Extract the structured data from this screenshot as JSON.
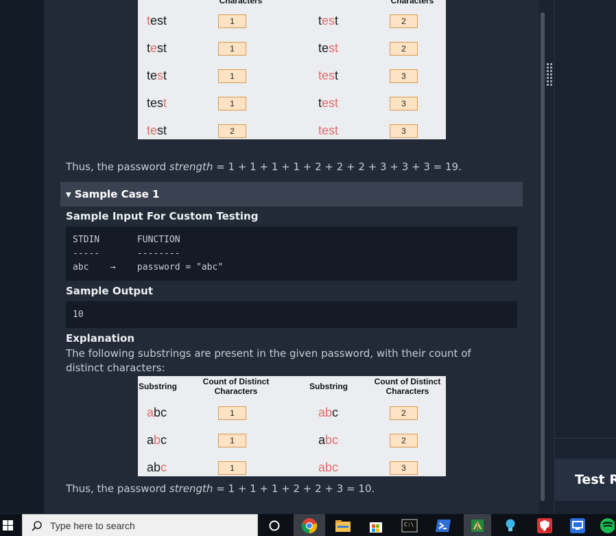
{
  "table1": {
    "header_left": "Characters",
    "header_right": "Characters",
    "rows": [
      {
        "left": {
          "pre": "",
          "hl": "t",
          "post": "est"
        },
        "left_count": "1",
        "right": {
          "pre": "t",
          "hl": "es",
          "post": "t"
        },
        "right_count": "2"
      },
      {
        "left": {
          "pre": "t",
          "hl": "e",
          "post": "st"
        },
        "left_count": "1",
        "right": {
          "pre": "te",
          "hl": "st",
          "post": ""
        },
        "right_count": "2"
      },
      {
        "left": {
          "pre": "te",
          "hl": "s",
          "post": "t"
        },
        "left_count": "1",
        "right": {
          "pre": "",
          "hl": "tes",
          "post": "t"
        },
        "right_count": "3"
      },
      {
        "left": {
          "pre": "tes",
          "hl": "t",
          "post": ""
        },
        "left_count": "1",
        "right": {
          "pre": "t",
          "hl": "est",
          "post": ""
        },
        "right_count": "3"
      },
      {
        "left": {
          "pre": "",
          "hl": "te",
          "post": "st"
        },
        "left_count": "2",
        "right": {
          "pre": "",
          "hl": "test",
          "post": ""
        },
        "right_count": "3"
      }
    ]
  },
  "strength0": {
    "prefix": "Thus, the password ",
    "word": "strength",
    "suffix": " = 1 + 1 + 1 + 1 + 2 + 2 + 2 + 3 + 3 + 3 = 19."
  },
  "sample_case": {
    "label": "▾ Sample Case 1"
  },
  "custom_input": {
    "title": "Sample Input For Custom Testing",
    "lines": [
      "STDIN       FUNCTION",
      "-----       --------",
      "abc    →    password = \"abc\""
    ]
  },
  "sample_output": {
    "title": "Sample Output",
    "value": "10"
  },
  "explanation": {
    "title": "Explanation",
    "text": "The following substrings are present in the given password, with their count of distinct characters:"
  },
  "table2": {
    "col1": "Substring",
    "col2": "Count of Distinct Characters",
    "col3": "Substring",
    "col4": "Count of Distinct Characters",
    "rows": [
      {
        "left": {
          "pre": "",
          "hl": "a",
          "post": "bc"
        },
        "left_count": "1",
        "right": {
          "pre": "",
          "hl": "ab",
          "post": "c"
        },
        "right_count": "2"
      },
      {
        "left": {
          "pre": "a",
          "hl": "b",
          "post": "c"
        },
        "left_count": "1",
        "right": {
          "pre": "a",
          "hl": "bc",
          "post": ""
        },
        "right_count": "2"
      },
      {
        "left": {
          "pre": "ab",
          "hl": "c",
          "post": ""
        },
        "left_count": "1",
        "right": {
          "pre": "",
          "hl": "abc",
          "post": ""
        },
        "right_count": "3"
      }
    ]
  },
  "strength1": {
    "prefix": "Thus, the password ",
    "word": "strength",
    "suffix": " = 1 + 1 + 1 + 2 + 2 + 3 = 10."
  },
  "right_pane": {
    "title": "Test Re"
  },
  "taskbar": {
    "search_placeholder": "Type here to search"
  }
}
